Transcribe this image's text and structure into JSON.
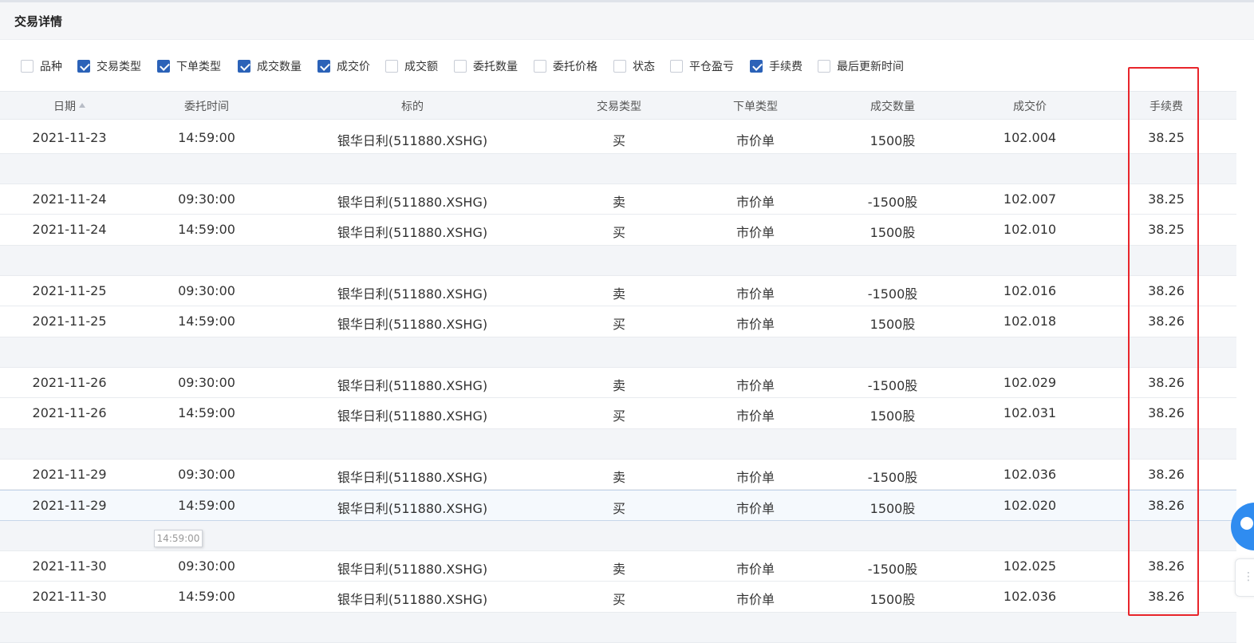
{
  "panel": {
    "title": "交易详情"
  },
  "filters": [
    {
      "label": "品种",
      "checked": false
    },
    {
      "label": "交易类型",
      "checked": true
    },
    {
      "label": "下单类型",
      "checked": true
    },
    {
      "label": "成交数量",
      "checked": true
    },
    {
      "label": "成交价",
      "checked": true
    },
    {
      "label": "成交额",
      "checked": false
    },
    {
      "label": "委托数量",
      "checked": false
    },
    {
      "label": "委托价格",
      "checked": false
    },
    {
      "label": "状态",
      "checked": false
    },
    {
      "label": "平仓盈亏",
      "checked": false
    },
    {
      "label": "手续费",
      "checked": true
    },
    {
      "label": "最后更新时间",
      "checked": false
    }
  ],
  "table": {
    "columns": [
      "日期",
      "委托时间",
      "标的",
      "交易类型",
      "下单类型",
      "成交数量",
      "成交价",
      "手续费"
    ],
    "sorted_column": "日期",
    "rows": [
      {
        "type": "data",
        "cells": [
          "2021-11-23",
          "14:59:00",
          "银华日利(511880.XSHG)",
          "买",
          "市价单",
          "1500股",
          "102.004",
          "38.25"
        ]
      },
      {
        "type": "spacer"
      },
      {
        "type": "data",
        "cells": [
          "2021-11-24",
          "09:30:00",
          "银华日利(511880.XSHG)",
          "卖",
          "市价单",
          "-1500股",
          "102.007",
          "38.25"
        ]
      },
      {
        "type": "data",
        "cells": [
          "2021-11-24",
          "14:59:00",
          "银华日利(511880.XSHG)",
          "买",
          "市价单",
          "1500股",
          "102.010",
          "38.25"
        ]
      },
      {
        "type": "spacer"
      },
      {
        "type": "data",
        "cells": [
          "2021-11-25",
          "09:30:00",
          "银华日利(511880.XSHG)",
          "卖",
          "市价单",
          "-1500股",
          "102.016",
          "38.26"
        ]
      },
      {
        "type": "data",
        "cells": [
          "2021-11-25",
          "14:59:00",
          "银华日利(511880.XSHG)",
          "买",
          "市价单",
          "1500股",
          "102.018",
          "38.26"
        ]
      },
      {
        "type": "spacer"
      },
      {
        "type": "data",
        "cells": [
          "2021-11-26",
          "09:30:00",
          "银华日利(511880.XSHG)",
          "卖",
          "市价单",
          "-1500股",
          "102.029",
          "38.26"
        ]
      },
      {
        "type": "data",
        "cells": [
          "2021-11-26",
          "14:59:00",
          "银华日利(511880.XSHG)",
          "买",
          "市价单",
          "1500股",
          "102.031",
          "38.26"
        ]
      },
      {
        "type": "spacer"
      },
      {
        "type": "data",
        "cells": [
          "2021-11-29",
          "09:30:00",
          "银华日利(511880.XSHG)",
          "卖",
          "市价单",
          "-1500股",
          "102.036",
          "38.26"
        ]
      },
      {
        "type": "data",
        "highlighted": true,
        "cells": [
          "2021-11-29",
          "14:59:00",
          "银华日利(511880.XSHG)",
          "买",
          "市价单",
          "1500股",
          "102.020",
          "38.26"
        ]
      },
      {
        "type": "spacer"
      },
      {
        "type": "data",
        "cells": [
          "2021-11-30",
          "09:30:00",
          "银华日利(511880.XSHG)",
          "卖",
          "市价单",
          "-1500股",
          "102.025",
          "38.26"
        ]
      },
      {
        "type": "data",
        "cells": [
          "2021-11-30",
          "14:59:00",
          "银华日利(511880.XSHG)",
          "买",
          "市价单",
          "1500股",
          "102.036",
          "38.26"
        ]
      },
      {
        "type": "spacer"
      }
    ]
  },
  "tooltip": {
    "text": "14:59:00"
  },
  "colors": {
    "checkbox_checked": "#2b62b8",
    "highlight_box": "#e8252b",
    "chat_button": "#2f8cf0"
  }
}
